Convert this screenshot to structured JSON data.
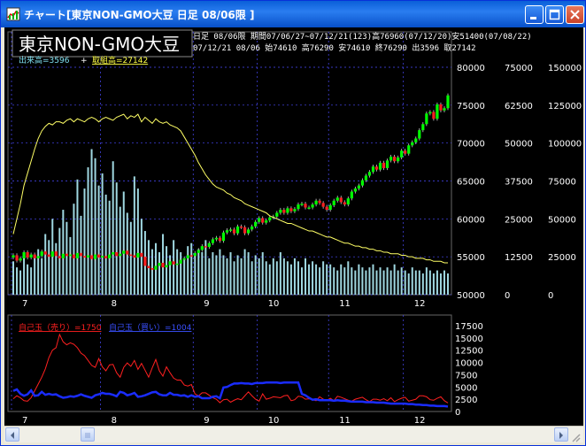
{
  "window": {
    "title": "チャート[東京NON-GMO大豆  日足 08/06限 ]",
    "chart_name": "東京NON-GMO大豆",
    "period_line": "日足  08/06限  期間07/06/27~07/12/21(123)高76960(07/12/20)安51400(07/08/22)",
    "ohlc_line": "07/12/21 08/06 始74610 高76290 安74610 終76290 出3596 取27142",
    "volume_label": "出来高=3596",
    "plus_sign": "+",
    "oi_label": "取組高=27142",
    "lower_label_red": "自己玉（売り）=1750",
    "lower_label_blue": "自己玉（買い）=1004"
  },
  "colors": {
    "title_blue": "#0a5fd8",
    "candle_up": "#00ff00",
    "candle_down": "#ff2020",
    "volume": "#9fd7e0",
    "oi_line": "#ffff66",
    "grid": "#4a4aff",
    "self_sell": "#ff2020",
    "self_buy": "#1a2cff"
  },
  "icons": {
    "title": "chart-app-icon",
    "minimize": "minimize-icon",
    "maximize": "maximize-icon",
    "close": "close-icon"
  },
  "axes": {
    "price_ticks": [
      "80000",
      "75000",
      "70000",
      "65000",
      "60000",
      "55000",
      "50000"
    ],
    "volume_ticks": [
      "75000",
      "62500",
      "50000",
      "37500",
      "25000",
      "12500",
      "0"
    ],
    "oi_ticks": [
      "150000",
      "125000",
      "100000",
      "75000",
      "50000",
      "25000",
      "0"
    ],
    "month_labels": [
      "7",
      "8",
      "9",
      "10",
      "11",
      "12"
    ],
    "lower_ticks": [
      "17500",
      "15000",
      "12500",
      "10000",
      "7500",
      "5000",
      "2500",
      "0"
    ]
  },
  "chart_data": [
    {
      "type": "candlestick",
      "ylim": [
        50000,
        80000
      ],
      "grid": true,
      "months": [
        "7",
        "8",
        "9",
        "10",
        "11",
        "12"
      ],
      "month_start_index": [
        0,
        25,
        51,
        69,
        89,
        110
      ],
      "close": [
        55200,
        54500,
        54800,
        55600,
        54900,
        55300,
        54800,
        55100,
        55700,
        55300,
        55000,
        55700,
        55100,
        54800,
        55400,
        55100,
        55300,
        54800,
        55500,
        55100,
        54900,
        55200,
        54700,
        55300,
        54900,
        55100,
        54800,
        55300,
        55600,
        55100,
        55400,
        55800,
        55300,
        55200,
        54900,
        55500,
        55000,
        53800,
        53500,
        53300,
        53800,
        54200,
        53600,
        53900,
        54400,
        54000,
        54100,
        54600,
        54800,
        55200,
        55100,
        55500,
        55900,
        56400,
        56300,
        56800,
        57300,
        57500,
        57100,
        58200,
        58500,
        58600,
        58100,
        59000,
        58900,
        58100,
        58600,
        59000,
        59600,
        60100,
        59500,
        59800,
        60200,
        60300,
        60800,
        61200,
        60800,
        61400,
        61000,
        61300,
        61900,
        62000,
        61500,
        61500,
        61900,
        62400,
        62100,
        61600,
        61200,
        61800,
        62400,
        62800,
        62200,
        61900,
        62700,
        63600,
        64000,
        64400,
        65100,
        65700,
        66200,
        66900,
        66500,
        67400,
        66700,
        67700,
        68200,
        67600,
        68100,
        69000,
        68600,
        69700,
        70100,
        70600,
        71700,
        72500,
        73900,
        74100,
        73200,
        75100,
        74300,
        74600,
        76290
      ],
      "volume_thousands": [
        11,
        9,
        8,
        14,
        10,
        9,
        13,
        15,
        12,
        20,
        18,
        25,
        17,
        22,
        28,
        24,
        19,
        30,
        38,
        26,
        35,
        42,
        48,
        45,
        36,
        40,
        33,
        31,
        44,
        37,
        29,
        34,
        27,
        24,
        39,
        35,
        25,
        21,
        18,
        15,
        17,
        14,
        20,
        16,
        13,
        18,
        15,
        14,
        12,
        16,
        17,
        13,
        15,
        14,
        18,
        12,
        14,
        13,
        15,
        13,
        12,
        14,
        11,
        13,
        12,
        15,
        14,
        11,
        13,
        12,
        14,
        11,
        10,
        12,
        11,
        14,
        12,
        11,
        10,
        12,
        11,
        9,
        12,
        10,
        11,
        10,
        9,
        11,
        10,
        10,
        9,
        8,
        10,
        9,
        11,
        9,
        8,
        10,
        9,
        8,
        9,
        10,
        8,
        9,
        8,
        9,
        8,
        10,
        8,
        9,
        8,
        7,
        9,
        8,
        8,
        7,
        9,
        8,
        7,
        8,
        7,
        8,
        7
      ],
      "open_interest_thousands": [
        40,
        50,
        60,
        72,
        80,
        88,
        96,
        103,
        108,
        111,
        113,
        112,
        114,
        114,
        113,
        115,
        116,
        114,
        116,
        115,
        114,
        116,
        117,
        116,
        114,
        116,
        117,
        116,
        115,
        117,
        118,
        119,
        116,
        118,
        117,
        119,
        114,
        117,
        115,
        113,
        116,
        114,
        113,
        114,
        112,
        111,
        110,
        108,
        104,
        100,
        96,
        92,
        87,
        83,
        79,
        76,
        73,
        71,
        70,
        69,
        67,
        66,
        64,
        63,
        62,
        60,
        59,
        58,
        57,
        56,
        55,
        54,
        52,
        51,
        50,
        49,
        48,
        47,
        47,
        46,
        45,
        44,
        43,
        42,
        42,
        41,
        40,
        39,
        38,
        38,
        37,
        36,
        35,
        34,
        34,
        33,
        32,
        32,
        31,
        31,
        30,
        30,
        29,
        29,
        28,
        28,
        27,
        27,
        27,
        26,
        26,
        25,
        25,
        24,
        24,
        24,
        23,
        23,
        22,
        22,
        22,
        21,
        21
      ]
    },
    {
      "type": "line",
      "ylim": [
        0,
        17500
      ],
      "series": [
        {
          "name": "自己玉（売り）",
          "values": [
            2600,
            3200,
            2800,
            2200,
            2100,
            2800,
            4200,
            5600,
            7000,
            8700,
            11000,
            12500,
            13000,
            15700,
            14200,
            13600,
            14000,
            13700,
            13000,
            11900,
            11400,
            10400,
            9400,
            9000,
            10800,
            9100,
            8300,
            9500,
            9600,
            7900,
            7000,
            9000,
            9900,
            9200,
            10400,
            8600,
            9800,
            8400,
            7000,
            8900,
            10600,
            8300,
            7200,
            9100,
            7900,
            6800,
            6400,
            6400,
            5400,
            5200,
            5500,
            3600,
            3200,
            3800,
            3800,
            3300,
            2800,
            2500,
            1800,
            2400,
            2500,
            1900,
            2300,
            2600,
            2400,
            3200,
            4000,
            3200,
            2500,
            2100,
            3600,
            2500,
            2700,
            3000,
            2900,
            2800,
            3200,
            3300,
            2200,
            2400,
            3100,
            3000,
            2500,
            2600,
            2400,
            2200,
            3000,
            2500,
            2300,
            2700,
            2200,
            3100,
            2900,
            2600,
            2300,
            2100,
            2500,
            2700,
            2900,
            2400,
            2000,
            2500,
            2500,
            2300,
            2600,
            2200,
            2800,
            2000,
            2400,
            2700,
            2900,
            2100,
            2300,
            2500,
            3200,
            3200,
            3000,
            2400,
            2300,
            2700,
            3000,
            2200,
            1750
          ]
        },
        {
          "name": "自己玉（買い）",
          "values": [
            4200,
            4500,
            3600,
            3200,
            3500,
            4300,
            3200,
            3300,
            4000,
            3400,
            3600,
            3400,
            3500,
            3100,
            2800,
            2900,
            3100,
            3000,
            3200,
            3500,
            3200,
            3000,
            2800,
            3300,
            3500,
            3800,
            3600,
            3600,
            3400,
            3100,
            4000,
            3800,
            3300,
            3500,
            3800,
            3000,
            3100,
            3300,
            3600,
            3900,
            4000,
            3500,
            3300,
            3300,
            3800,
            3400,
            3400,
            3200,
            3300,
            3000,
            3300,
            3000,
            3100,
            2700,
            2700,
            2700,
            3000,
            3100,
            2700,
            4900,
            5000,
            5400,
            5700,
            5700,
            5800,
            5700,
            5700,
            5600,
            5800,
            5800,
            5800,
            5900,
            5900,
            5900,
            5900,
            5800,
            5900,
            5900,
            5900,
            5900,
            5900,
            3600,
            3300,
            2800,
            2400,
            2500,
            2300,
            2300,
            2300,
            2300,
            2200,
            2300,
            2200,
            2200,
            2100,
            2000,
            2000,
            2000,
            2000,
            1900,
            1900,
            1900,
            1800,
            1800,
            1800,
            1700,
            1600,
            1600,
            1600,
            1600,
            1600,
            1500,
            1500,
            1400,
            1400,
            1300,
            1300,
            1200,
            1200,
            1100,
            1100,
            1100,
            1004
          ]
        }
      ]
    }
  ]
}
